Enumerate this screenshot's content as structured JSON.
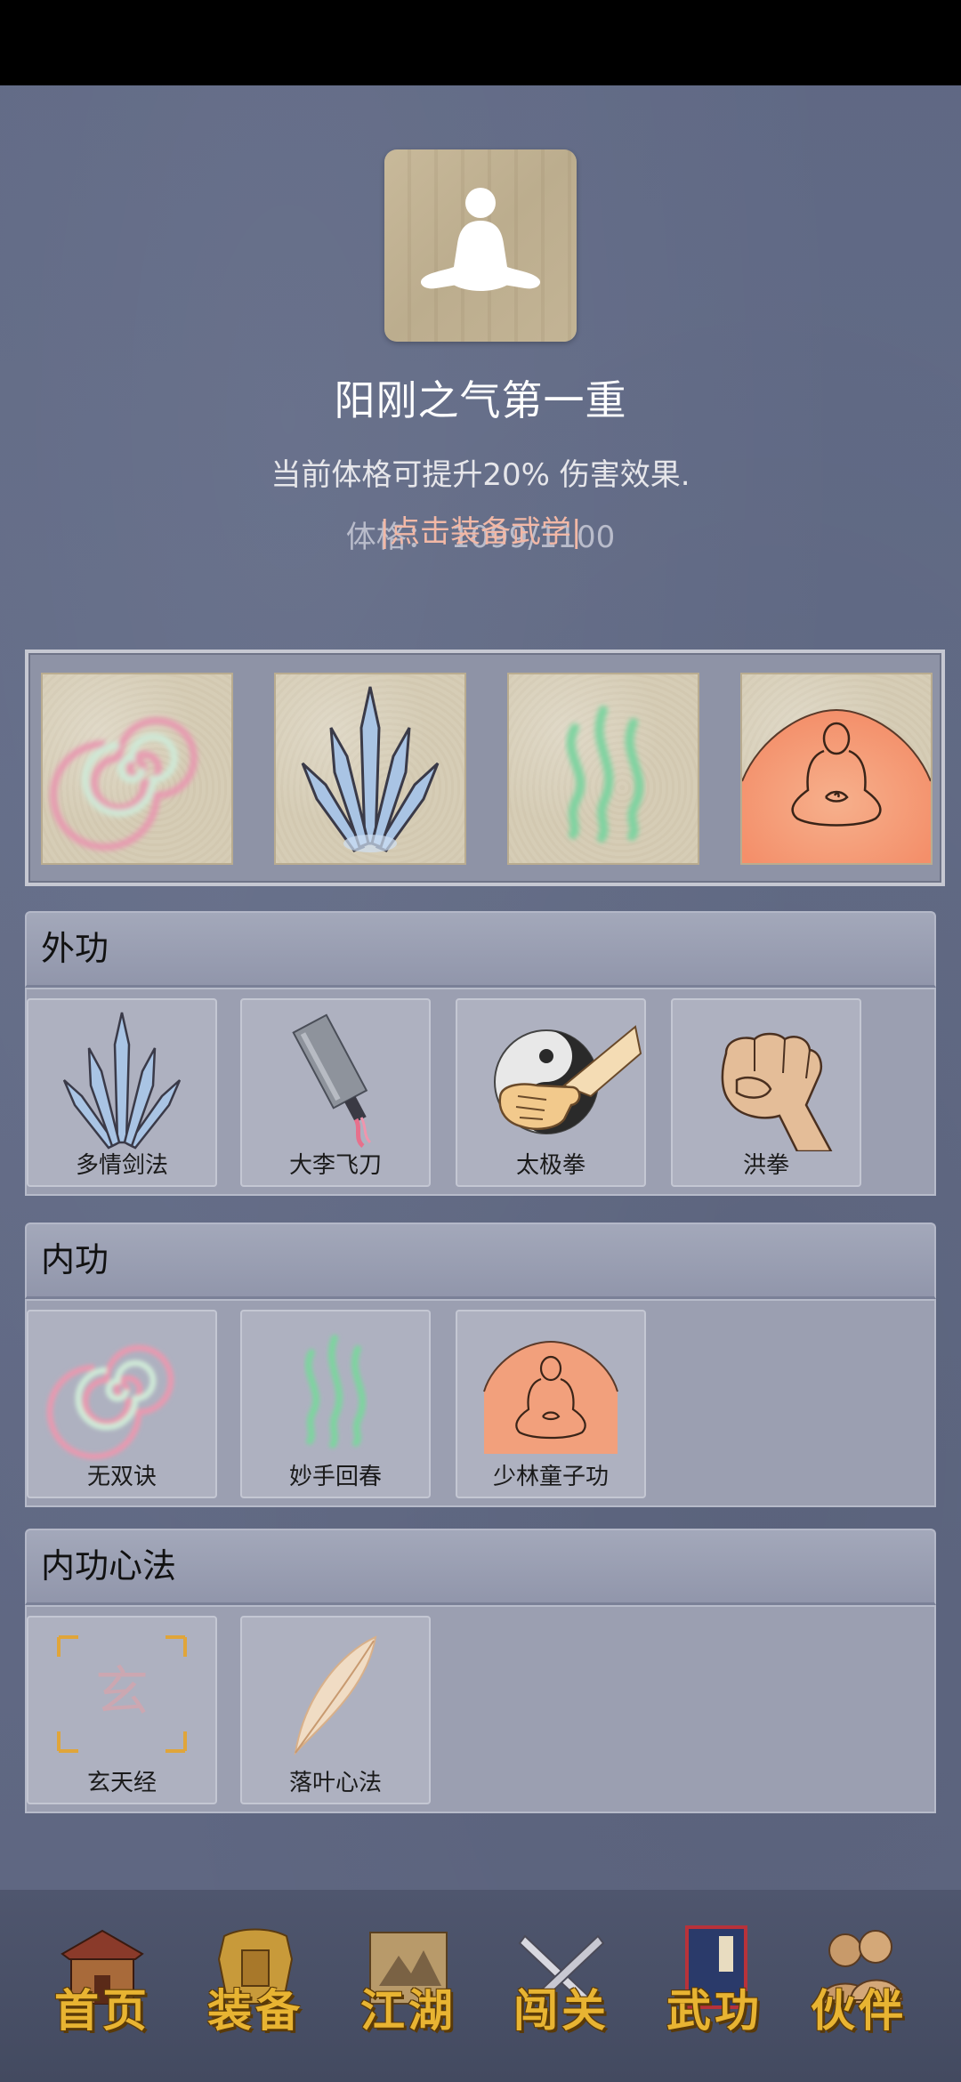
{
  "hero": {
    "title": "阳刚之气第一重",
    "description": "当前体格可提升20% 伤害效果.",
    "stat_label": "体格：",
    "stat_value": "1099/1100",
    "icon": "meditating-figure-icon"
  },
  "equip_link": "|点击装备武学|",
  "equipped_slots": [
    {
      "icon": "spiral-icon"
    },
    {
      "icon": "crystal-swords-icon"
    },
    {
      "icon": "green-waves-icon"
    },
    {
      "icon": "meditating-monk-icon"
    }
  ],
  "sections": {
    "waigong": {
      "title": "外功",
      "skills": [
        {
          "name": "多情剑法",
          "icon": "crystal-swords-icon"
        },
        {
          "name": "大李飞刀",
          "icon": "flying-knife-icon"
        },
        {
          "name": "太极拳",
          "icon": "yin-yang-fist-icon"
        },
        {
          "name": "洪拳",
          "icon": "fist-icon"
        }
      ]
    },
    "neigong": {
      "title": "内功",
      "skills": [
        {
          "name": "无双诀",
          "icon": "spiral-icon"
        },
        {
          "name": "妙手回春",
          "icon": "green-waves-icon"
        },
        {
          "name": "少林童子功",
          "icon": "meditating-monk-icon"
        }
      ]
    },
    "xinfa": {
      "title": "内功心法",
      "skills": [
        {
          "name": "玄天经",
          "icon": "xuan-scroll-icon",
          "glyph": "玄"
        },
        {
          "name": "落叶心法",
          "icon": "feather-icon"
        }
      ]
    }
  },
  "nav": [
    {
      "label": "首页",
      "icon": "house-icon"
    },
    {
      "label": "装备",
      "icon": "armor-icon"
    },
    {
      "label": "江湖",
      "icon": "scroll-map-icon"
    },
    {
      "label": "闯关",
      "icon": "crossed-swords-icon"
    },
    {
      "label": "武功",
      "icon": "book-icon"
    },
    {
      "label": "伙伴",
      "icon": "companions-icon"
    }
  ],
  "colors": {
    "background": "#5f6884",
    "link": "#f2b8a6",
    "nav_label": "#e8b432"
  }
}
